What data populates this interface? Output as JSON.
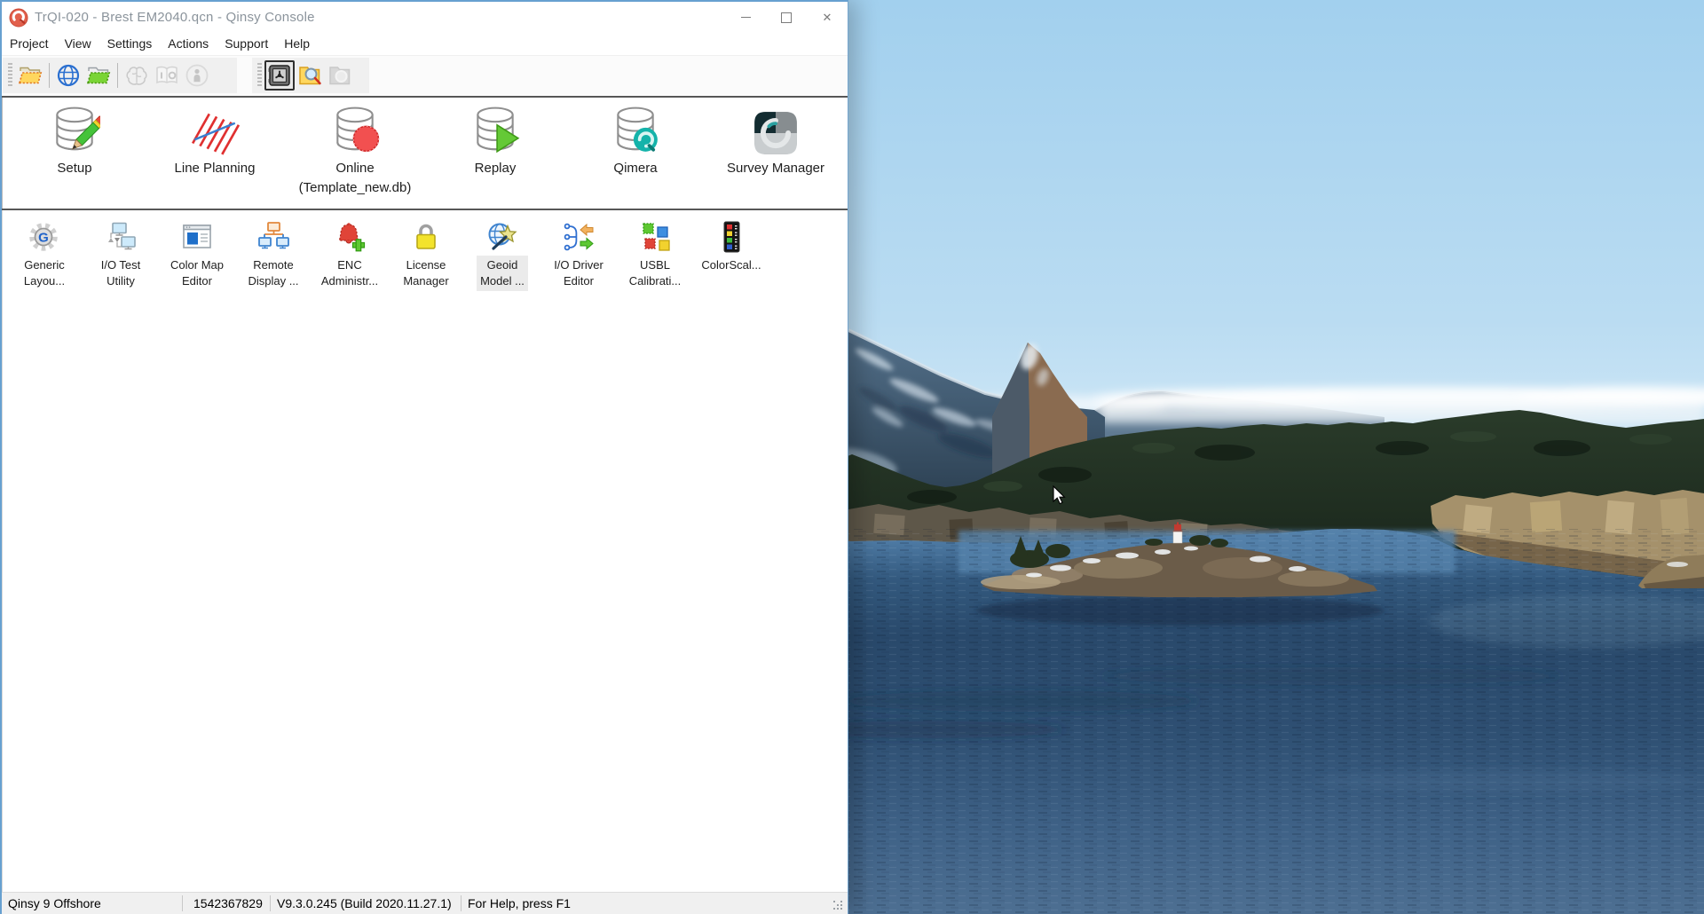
{
  "window": {
    "title": "TrQI-020 - Brest EM2040.qcn - Qinsy Console",
    "app_logo": "qinsy-logo-icon",
    "controls": [
      {
        "name": "minimize-button",
        "icon": "minimize-icon"
      },
      {
        "name": "maximize-button",
        "icon": "maximize-icon"
      },
      {
        "name": "close-button",
        "icon": "close-icon",
        "glyph": "✕"
      }
    ]
  },
  "menu": {
    "items": [
      "Project",
      "View",
      "Settings",
      "Actions",
      "Support",
      "Help"
    ]
  },
  "toolbar": {
    "groups": [
      {
        "items": [
          "open-project-folder-icon",
          "globe-icon",
          "open-template-folder-icon",
          "brain-icon",
          "io-book-icon",
          "person-info-icon"
        ],
        "disabled": [
          "brain-icon",
          "io-book-icon",
          "person-info-icon"
        ]
      },
      {
        "items": [
          "database-safe-icon",
          "folder-search-icon",
          "folder-disabled-icon"
        ],
        "pressed": [
          "database-safe-icon"
        ],
        "disabled": [
          "folder-disabled-icon"
        ]
      }
    ]
  },
  "launcher": {
    "items": [
      {
        "label": "Setup",
        "icon": "database-pencil-icon"
      },
      {
        "label": "Line Planning",
        "icon": "line-planning-icon"
      },
      {
        "label": "Online",
        "sublabel": "(Template_new.db)",
        "icon": "database-online-icon"
      },
      {
        "label": "Replay",
        "icon": "database-replay-icon"
      },
      {
        "label": "Qimera",
        "icon": "qimera-icon"
      },
      {
        "label": "Survey Manager",
        "icon": "survey-manager-icon"
      }
    ]
  },
  "tools": {
    "items": [
      {
        "line1": "Generic",
        "line2": "Layou...",
        "icon": "generic-layout-icon",
        "selected": false
      },
      {
        "line1": "I/O Test",
        "line2": "Utility",
        "icon": "io-test-utility-icon",
        "selected": false
      },
      {
        "line1": "Color Map",
        "line2": "Editor",
        "icon": "color-map-editor-icon",
        "selected": false
      },
      {
        "line1": "Remote",
        "line2": "Display ...",
        "icon": "remote-display-icon",
        "selected": false
      },
      {
        "line1": "ENC",
        "line2": "Administr...",
        "icon": "enc-administrator-icon",
        "selected": false
      },
      {
        "line1": "License",
        "line2": "Manager",
        "icon": "license-manager-icon",
        "selected": false
      },
      {
        "line1": "Geoid",
        "line2": "Model ...",
        "icon": "geoid-model-icon",
        "selected": true
      },
      {
        "line1": "I/O Driver",
        "line2": "Editor",
        "icon": "io-driver-editor-icon",
        "selected": false
      },
      {
        "line1": "USBL",
        "line2": "Calibrati...",
        "icon": "usbl-calibration-icon",
        "selected": false
      },
      {
        "line1": "ColorScal...",
        "line2": "",
        "icon": "colorscale-icon",
        "selected": false
      }
    ]
  },
  "statusbar": {
    "sections": [
      "Qinsy 9 Offshore",
      "1542367829",
      "V9.3.0.245 (Build 2020.11.27.1)",
      "For Help, press F1"
    ]
  },
  "colors": {
    "accent_border": "#67a0d0",
    "toolbar_bg": "#f0f0f0",
    "selection_bg": "#ebebeb",
    "statusbar_bg": "#f0f0f0",
    "title_text": "#8b949c"
  }
}
